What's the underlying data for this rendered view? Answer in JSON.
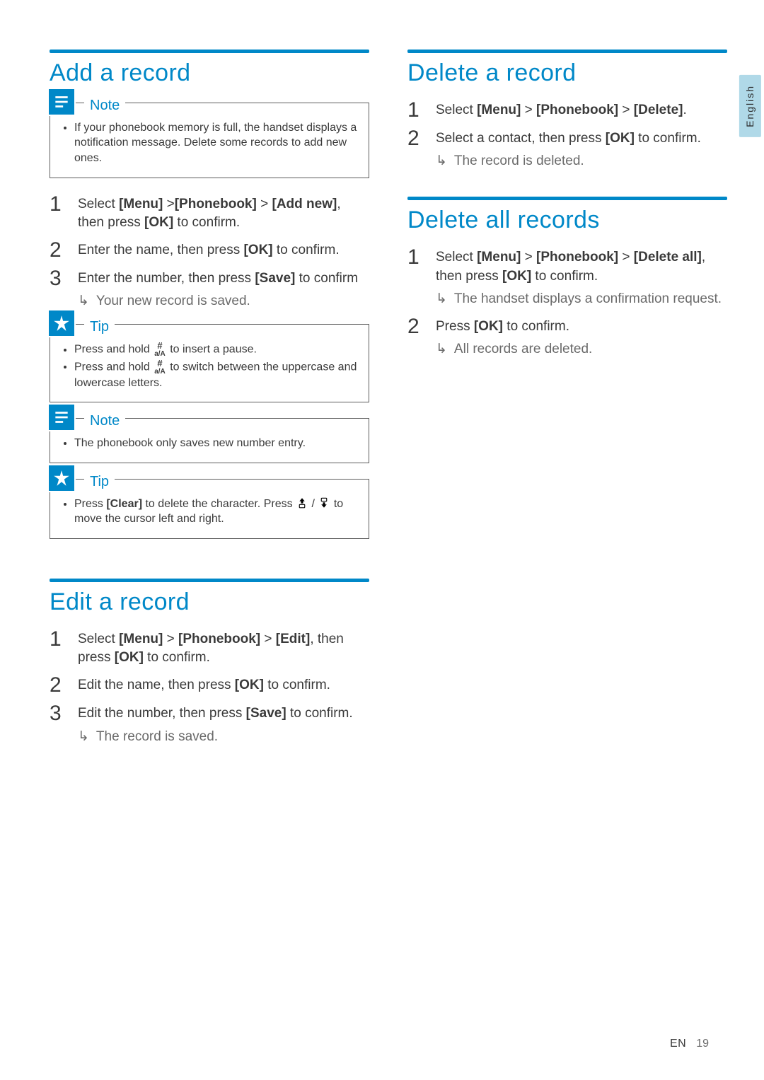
{
  "lang_tab": "English",
  "footer": {
    "lang": "EN",
    "page": "19"
  },
  "box": {
    "note_label": "Note",
    "tip_label": "Tip"
  },
  "keys": {
    "menu": "[Menu]",
    "phonebook": "[Phonebook]",
    "addnew": "[Add new]",
    "ok": "[OK]",
    "save": "[Save]",
    "edit": "[Edit]",
    "delete": "[Delete]",
    "deleteall": "[Delete all]",
    "clear": "[Clear]"
  },
  "add": {
    "title": "Add a record",
    "note1": "If your phonebook memory is full, the handset displays a notification message. Delete some records to add new ones.",
    "s1_a": "Select ",
    "s1_b": " >",
    "s1_c": " > ",
    "s1_d": ", then press ",
    "s1_e": " to confirm.",
    "s2_a": "Enter the name, then press ",
    "s2_b": " to confirm.",
    "s3_a": "Enter the number, then press ",
    "s3_b": " to confirm",
    "s3_res": "Your new record is saved.",
    "tip1_a": "Press and hold ",
    "tip1_b": " to insert a pause.",
    "tip2_a": "Press and hold ",
    "tip2_b": " to switch between the uppercase and lowercase letters.",
    "note2": "The phonebook only saves new number entry.",
    "tip3_a": "Press ",
    "tip3_b": " to delete the character. Press ",
    "tip3_c": " / ",
    "tip3_d": " to move the cursor left and right."
  },
  "editrec": {
    "title": "Edit a record",
    "s1_a": "Select ",
    "s1_b": " > ",
    "s1_c": " > ",
    "s1_d": ", then press ",
    "s1_e": " to confirm.",
    "s2_a": "Edit the name, then press ",
    "s2_b": " to confirm.",
    "s3_a": "Edit the number, then press ",
    "s3_b": " to confirm.",
    "s3_res": "The record is saved."
  },
  "del": {
    "title": "Delete a record",
    "s1_a": "Select ",
    "s1_b": " > ",
    "s1_c": " > ",
    "s1_d": ".",
    "s2_a": "Select a contact, then press ",
    "s2_b": " to confirm.",
    "s2_res": "The record is deleted."
  },
  "delall": {
    "title": "Delete all records",
    "s1_a": "Select ",
    "s1_b": " > ",
    "s1_c": " > ",
    "s1_d": ", then press ",
    "s1_e": " to confirm.",
    "s1_res": "The handset displays a confirmation request.",
    "s2_a": "Press ",
    "s2_b": " to confirm.",
    "s2_res": "All records are deleted."
  }
}
